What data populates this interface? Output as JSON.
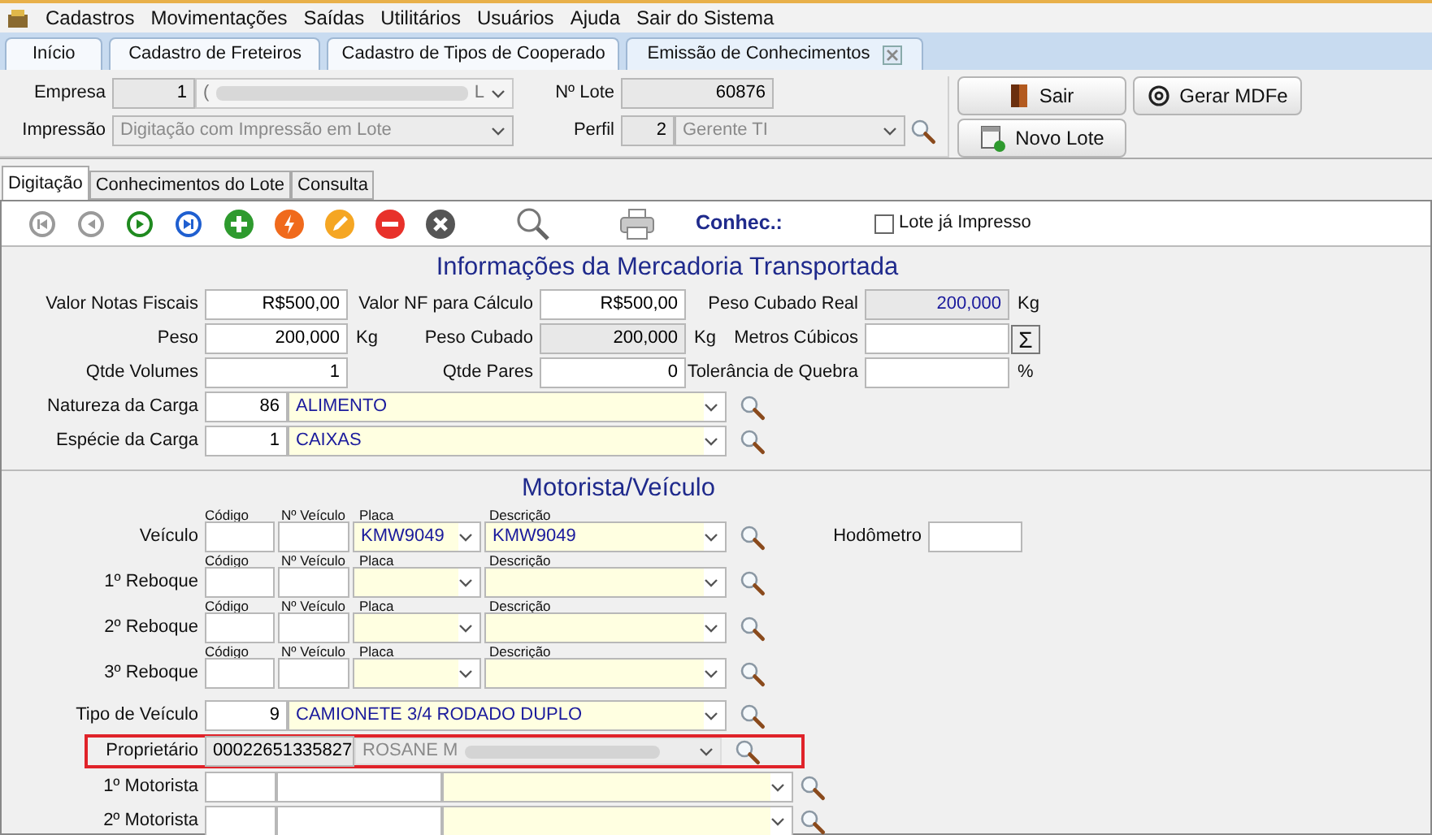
{
  "menu": [
    "Cadastros",
    "Movimentações",
    "Saídas",
    "Utilitários",
    "Usuários",
    "Ajuda",
    "Sair do Sistema"
  ],
  "tabs": [
    {
      "label": "Início",
      "selected": false,
      "closable": false
    },
    {
      "label": "Cadastro de Freteiros",
      "selected": false,
      "closable": false
    },
    {
      "label": "Cadastro de Tipos de Cooperado",
      "selected": false,
      "closable": false
    },
    {
      "label": "Emissão de Conhecimentos",
      "selected": true,
      "closable": true
    }
  ],
  "header": {
    "empresa": {
      "label": "Empresa",
      "code": "1",
      "name_start": "(",
      "name_end": "L"
    },
    "lote": {
      "label": "Nº Lote",
      "value": "60876"
    },
    "impressao": {
      "label": "Impressão",
      "value": "Digitação com Impressão em Lote",
      "disabled": true
    },
    "perfil": {
      "label": "Perfil",
      "code": "2",
      "value": "Gerente TI"
    }
  },
  "buttons": [
    {
      "label": "Sair",
      "kind": "exit"
    },
    {
      "label": "Gerar MDFe",
      "kind": "mdfe"
    },
    {
      "label": "Novo Lote",
      "kind": "new"
    }
  ],
  "subtabs": [
    {
      "label": "Digitação",
      "selected": true
    },
    {
      "label": "Conhecimentos do Lote",
      "selected": false
    },
    {
      "label": "Consulta",
      "selected": false
    }
  ],
  "toolbar": {
    "items": [
      {
        "kind": "first",
        "disabled": true
      },
      {
        "kind": "prev",
        "disabled": true
      },
      {
        "kind": "next",
        "disabled": false
      },
      {
        "kind": "last",
        "disabled": false
      },
      {
        "kind": "add",
        "disabled": false
      },
      {
        "kind": "flash",
        "disabled": false
      },
      {
        "kind": "edit",
        "disabled": false
      },
      {
        "kind": "remove",
        "disabled": false
      },
      {
        "kind": "cancel",
        "disabled": false
      },
      {
        "kind": "search",
        "disabled": false
      },
      {
        "kind": "print",
        "disabled": false
      }
    ],
    "label": "Conhec.:",
    "checkbox": {
      "label": "Lote já Impresso",
      "checked": false
    }
  },
  "cargo": {
    "title": "Informações da Mercadoria Transportada",
    "rows": [
      [
        {
          "label": "Valor Notas Fiscais",
          "value": "R$500,00",
          "readonly": false
        },
        {
          "label": "Valor NF para Cálculo",
          "value": "R$500,00",
          "readonly": false
        },
        {
          "label": "Peso Cubado Real",
          "value": "200,000",
          "readonly": true,
          "unit": "Kg"
        }
      ],
      [
        {
          "label": "Peso",
          "value": "200,000",
          "readonly": false,
          "unit": "Kg"
        },
        {
          "label": "Peso Cubado",
          "value": "200,000",
          "readonly": true,
          "unit": "Kg"
        },
        {
          "label": "Metros Cúbicos",
          "readonly": false,
          "button": "Σ"
        }
      ],
      [
        {
          "label": "Qtde Volumes",
          "value": "1",
          "readonly": false
        },
        {
          "label": "Qtde Pares",
          "value": "0",
          "readonly": false
        },
        {
          "label": "Tolerância de Quebra",
          "readonly": false,
          "unit": "%"
        }
      ]
    ],
    "lookups": [
      {
        "label": "Natureza da Carga",
        "code": "86",
        "value": "ALIMENTO"
      },
      {
        "label": "Espécie da Carga",
        "code": "1",
        "value": "CAIXAS"
      }
    ]
  },
  "vehicle": {
    "title": "Motorista/Veículo",
    "rows": [
      {
        "label": "Veículo",
        "heads": [
          "Código",
          "Nº Veículo",
          "Placa",
          "Descrição"
        ],
        "placa": "KMW9049",
        "descricao": "KMW9049"
      },
      {
        "label": "1º Reboque",
        "heads": [
          "Código",
          "Nº Veículo",
          "Placa",
          "Descrição"
        ]
      },
      {
        "label": "2º Reboque",
        "heads": [
          "Código",
          "Nº Veículo",
          "Placa",
          "Descrição"
        ]
      },
      {
        "label": "3º Reboque",
        "heads": [
          "Código",
          "Nº Veículo",
          "Placa",
          "Descrição"
        ]
      }
    ],
    "hodometro": {
      "label": "Hodômetro"
    },
    "tipo": {
      "label": "Tipo de Veículo",
      "code": "9",
      "value": "CAMIONETE 3/4 RODADO DUPLO"
    },
    "proprietario": {
      "label": "Proprietário",
      "code": "00022651335827",
      "name_start": "ROSANE M",
      "highlighted": true,
      "disabled": true
    },
    "motoristas": [
      {
        "label": "1º Motorista"
      },
      {
        "label": "2º Motorista"
      }
    ]
  }
}
